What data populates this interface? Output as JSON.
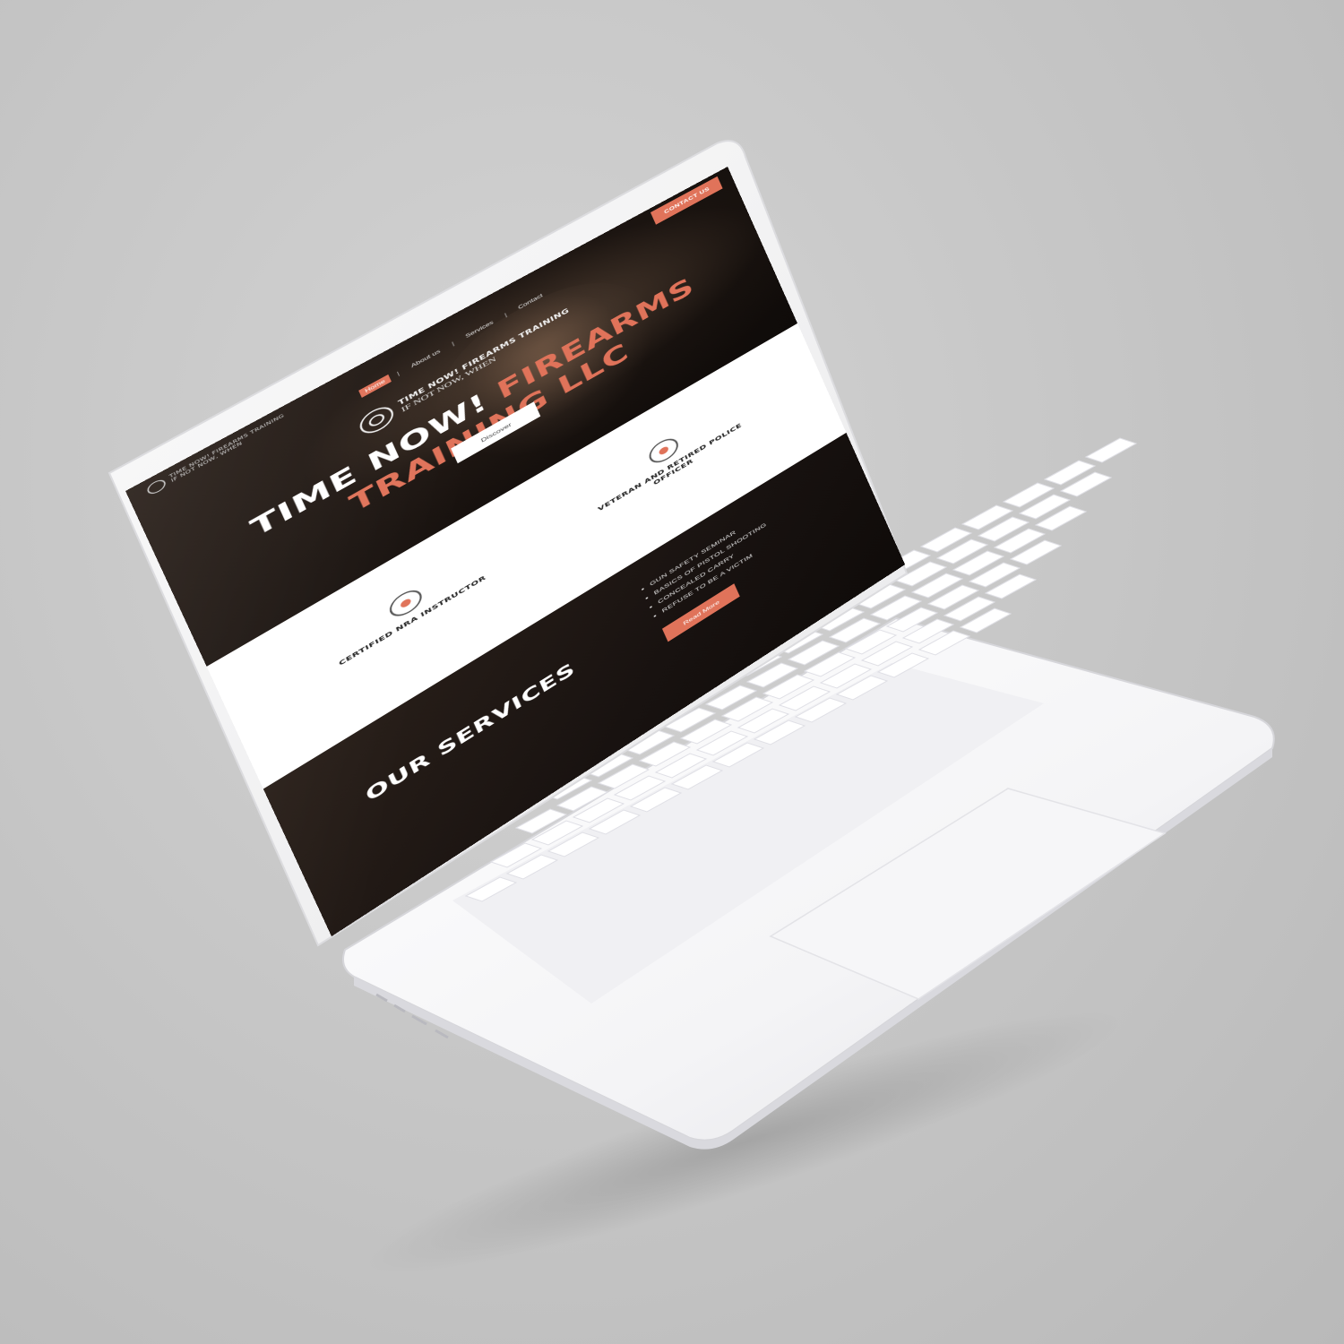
{
  "site": {
    "top_logo": {
      "line1": "TIME NOW! FIREARMS TRAINING",
      "line2": "IF NOT NOW, WHEN"
    },
    "contact_button": "CONTACT US",
    "nav": [
      "Home",
      "About us",
      "Services",
      "Contact"
    ],
    "nav_active": "Home",
    "center_logo": {
      "line1": "TIME NOW! FIREARMS TRAINING",
      "line2": "IF NOT NOW, WHEN"
    },
    "headline": {
      "white": "TIME NOW! ",
      "orange": "FIREARMS TRAINING LLC"
    },
    "discover_button": "Discover",
    "features": [
      {
        "label": "CERTIFIED NRA INSTRUCTOR",
        "icon": "target-icon"
      },
      {
        "label": "VETERAN AND RETIRED POLICE OFFICER",
        "icon": "police-badge-icon"
      }
    ],
    "services": {
      "title": "OUR SERVICES",
      "items": [
        "GUN SAFETY SEMINAR",
        "BASICS OF PISTOL SHOOTING",
        "CONCEALED CARRY",
        "REFUSE TO BE A VICTIM"
      ],
      "read_more": "Read More"
    },
    "colors": {
      "accent": "#e0735a",
      "dark": "#17110e",
      "light": "#ffffff"
    }
  }
}
